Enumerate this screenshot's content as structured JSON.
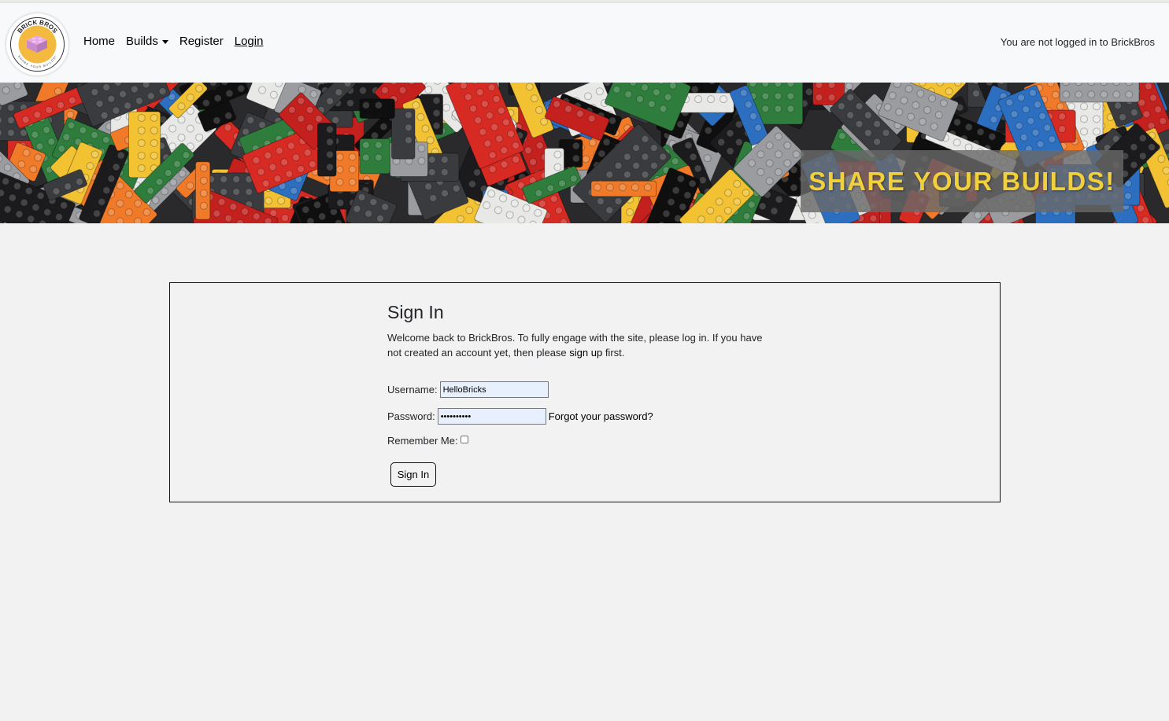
{
  "site": {
    "name": "BrickBros",
    "logo_text": "BRICK BROS",
    "logo_tagline": "SHARE YOUR BUILDS!"
  },
  "nav": {
    "home": "Home",
    "builds": "Builds",
    "register": "Register",
    "login": "Login",
    "status": "You are not logged in to BrickBros"
  },
  "hero": {
    "banner_text": "SHARE YOUR BUILDS!"
  },
  "signin": {
    "title": "Sign In",
    "intro_before": "Welcome back to BrickBros. To fully engage with the site, please log in. If you have not created an account yet, then please ",
    "intro_link": "sign up",
    "intro_after": " first.",
    "username_label": "Username:",
    "username_value": "HelloBricks",
    "password_label": "Password:",
    "password_value": "••••••••••",
    "forgot_link": "Forgot your password?",
    "remember_label": "Remember Me:",
    "remember_checked": false,
    "submit_label": "Sign In"
  },
  "colors": {
    "accent_text": "#f2d03b",
    "navbar_bg": "#f8f9fa",
    "page_bg": "#f2f2f2",
    "autofill_bg": "#e8f0fe"
  }
}
